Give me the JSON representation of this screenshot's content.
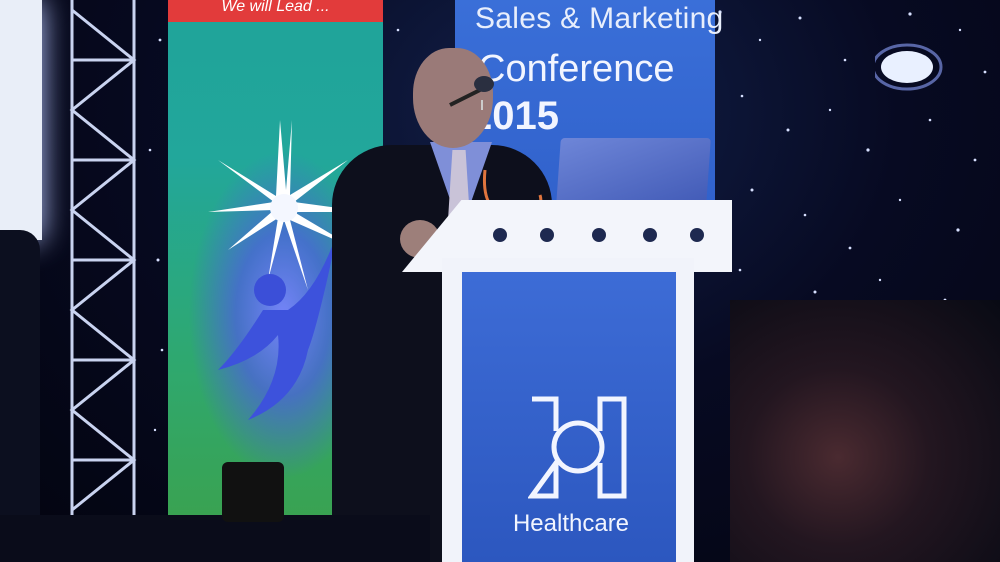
{
  "banner_left": {
    "top_text": "We will Lead ..."
  },
  "banner_right": {
    "title": "Sales & Marketing",
    "subtitle": "Conference",
    "year": "2015"
  },
  "podium": {
    "brand": "Healthcare"
  },
  "colors": {
    "banner_blue": "#3a6fd8",
    "podium_blue": "#2c57bf",
    "banner_green": "#2fa86e",
    "banner_red": "#e23b3b",
    "night_sky": "#05071a"
  },
  "icons": [
    "star-burst-icon",
    "running-figure-icon",
    "microphone-icon",
    "healthcare-logo-icon",
    "laptop-icon",
    "spotlight-icon"
  ]
}
